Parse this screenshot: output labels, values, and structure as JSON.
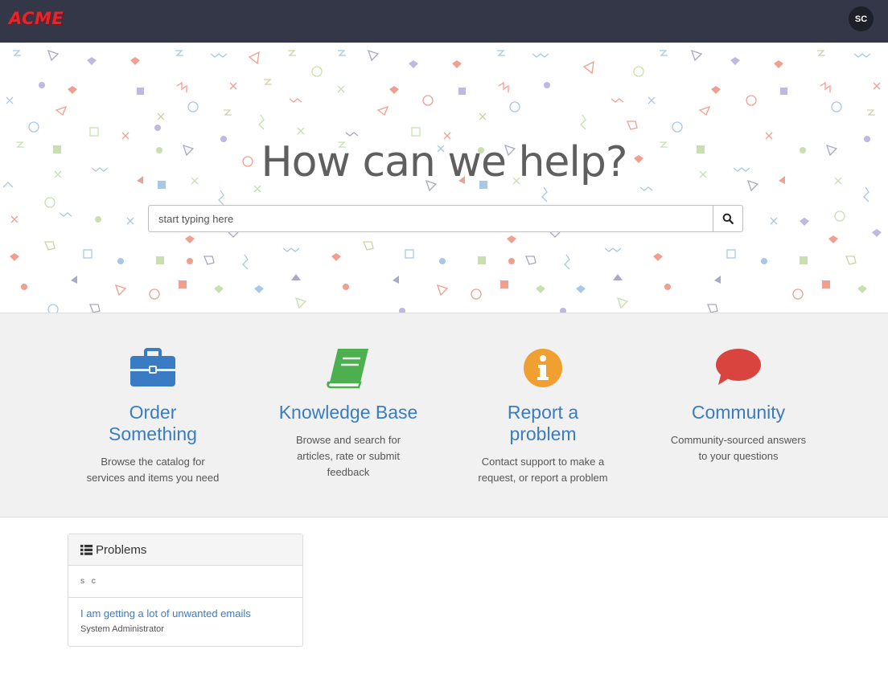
{
  "header": {
    "logo_text": "ACME",
    "avatar_initials": "SC"
  },
  "hero": {
    "title": "How can we help?",
    "search_placeholder": "start typing here"
  },
  "tiles": [
    {
      "title": "Order Something",
      "description": "Browse the catalog for services and items you need",
      "icon": "briefcase-icon",
      "color": "#3a7cc4"
    },
    {
      "title": "Knowledge Base",
      "description": "Browse and search for articles, rate or submit feedback",
      "icon": "book-icon",
      "color": "#4caf50"
    },
    {
      "title": "Report a problem",
      "description": "Contact support to make a request, or report a problem",
      "icon": "info-icon",
      "color": "#f0a030"
    },
    {
      "title": "Community",
      "description": "Community-sourced answers to your questions",
      "icon": "speech-bubble-icon",
      "color": "#d9443f"
    }
  ],
  "problems": {
    "title": "Problems",
    "subheader": "s c",
    "items": [
      {
        "title": "I am getting a lot of unwanted emails",
        "author": "System Administrator"
      }
    ]
  },
  "colors": {
    "topbar": "#343748",
    "link": "#3a7cc4",
    "logo": "#e3262b"
  }
}
